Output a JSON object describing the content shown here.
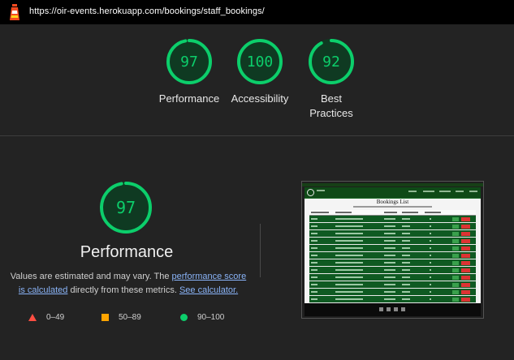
{
  "url_bar": {
    "url": "https://oir-events.herokuapp.com/bookings/staff_bookings/"
  },
  "summary_scores": [
    {
      "score": "97",
      "label": "Performance",
      "fraction": 0.97
    },
    {
      "score": "100",
      "label": "Accessibility",
      "fraction": 1.0
    },
    {
      "score": "92",
      "label": "Best Practices",
      "fraction": 0.92
    }
  ],
  "performance": {
    "score": "97",
    "fraction": 0.97,
    "title": "Performance",
    "desc_prefix": "Values are estimated and may vary. The ",
    "desc_link1": "performance score is calculated",
    "desc_middle": " directly from these metrics. ",
    "desc_link2": "See calculator."
  },
  "legend": [
    {
      "icon": "triangle",
      "range": "0–49",
      "color": "#ff4e42"
    },
    {
      "icon": "square",
      "range": "50–89",
      "color": "#ffa400"
    },
    {
      "icon": "circle",
      "range": "90–100",
      "color": "#0cce6b"
    }
  ],
  "screenshot_thumbnail": {
    "page_title": "Bookings List",
    "rows": 12
  },
  "colors": {
    "pass": "#0cce6b",
    "background": "#232323",
    "gauge_track": "#0f3a22"
  }
}
